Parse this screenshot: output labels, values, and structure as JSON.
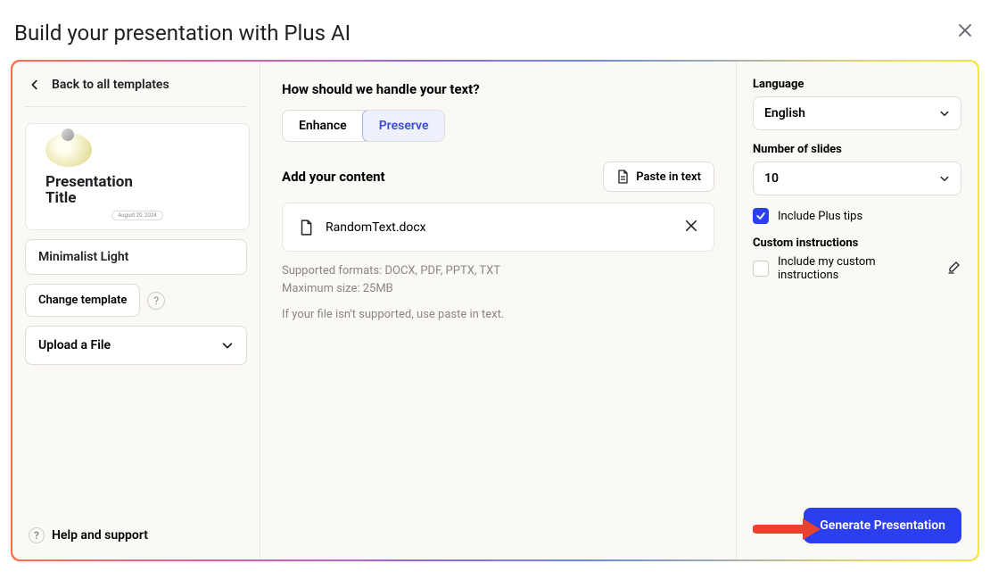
{
  "header": {
    "title": "Build your presentation with Plus AI"
  },
  "left": {
    "back_label": "Back to all templates",
    "thumbnail": {
      "title_line1": "Presentation",
      "title_line2": "Title",
      "date": "August 20, 2024"
    },
    "template_name": "Minimalist Light",
    "change_template_label": "Change template",
    "upload_label": "Upload a File",
    "help_support_label": "Help and support"
  },
  "center": {
    "text_handling_heading": "How should we handle your text?",
    "enhance_label": "Enhance",
    "preserve_label": "Preserve",
    "add_content_heading": "Add your content",
    "paste_in_text_label": "Paste in text",
    "file": {
      "name": "RandomText.docx"
    },
    "help_formats": "Supported formats: DOCX, PDF, PPTX, TXT",
    "help_max": "Maximum size: 25MB",
    "help_fallback": "If your file isn't supported, use paste in text."
  },
  "right": {
    "language_label": "Language",
    "language_value": "English",
    "slides_label": "Number of slides",
    "slides_value": "10",
    "include_tips_label": "Include Plus tips",
    "custom_instructions_label": "Custom instructions",
    "include_custom_label": "Include my custom instructions"
  },
  "footer": {
    "generate_label": "Generate Presentation"
  }
}
